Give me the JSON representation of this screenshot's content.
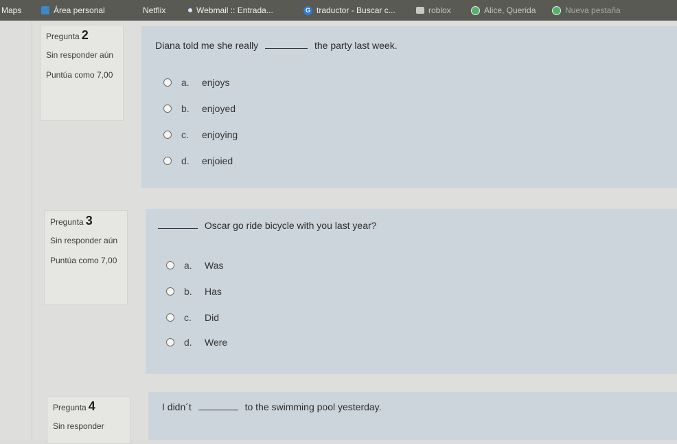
{
  "bookmarks": [
    {
      "label": "Maps",
      "icon": "none"
    },
    {
      "label": "Área personal",
      "icon": "moodle-icon"
    },
    {
      "label": "Netflix",
      "icon": "none"
    },
    {
      "label": "Webmail :: Entrada...",
      "icon": "webmail-icon"
    },
    {
      "label": "traductor - Buscar c...",
      "icon": "google-icon"
    },
    {
      "label": "roblox",
      "icon": "roblox-icon"
    },
    {
      "label": "Alice, Querida",
      "icon": "globe-icon"
    },
    {
      "label": "Nueva pestaña",
      "icon": "globe-icon"
    }
  ],
  "questions": [
    {
      "label": "Pregunta",
      "number": "2",
      "status": "Sin responder aún",
      "marks": "Puntúa como 7,00",
      "text_before": "Diana told me she really",
      "text_after": "the party last week.",
      "options": [
        {
          "letter": "a.",
          "text": "enjoys"
        },
        {
          "letter": "b.",
          "text": "enjoyed"
        },
        {
          "letter": "c.",
          "text": "enjoying"
        },
        {
          "letter": "d.",
          "text": "enjoied"
        }
      ]
    },
    {
      "label": "Pregunta",
      "number": "3",
      "status": "Sin responder aún",
      "marks": "Puntúa como 7,00",
      "text_before": "",
      "text_after": "Oscar go ride bicycle with you last year?",
      "options": [
        {
          "letter": "a.",
          "text": "Was"
        },
        {
          "letter": "b.",
          "text": "Has"
        },
        {
          "letter": "c.",
          "text": "Did"
        },
        {
          "letter": "d.",
          "text": "Were"
        }
      ]
    },
    {
      "label": "Pregunta",
      "number": "4",
      "status": "Sin responder",
      "marks": "",
      "text_before": "I didn´t",
      "text_after": "to the swimming pool yesterday.",
      "options": []
    }
  ]
}
